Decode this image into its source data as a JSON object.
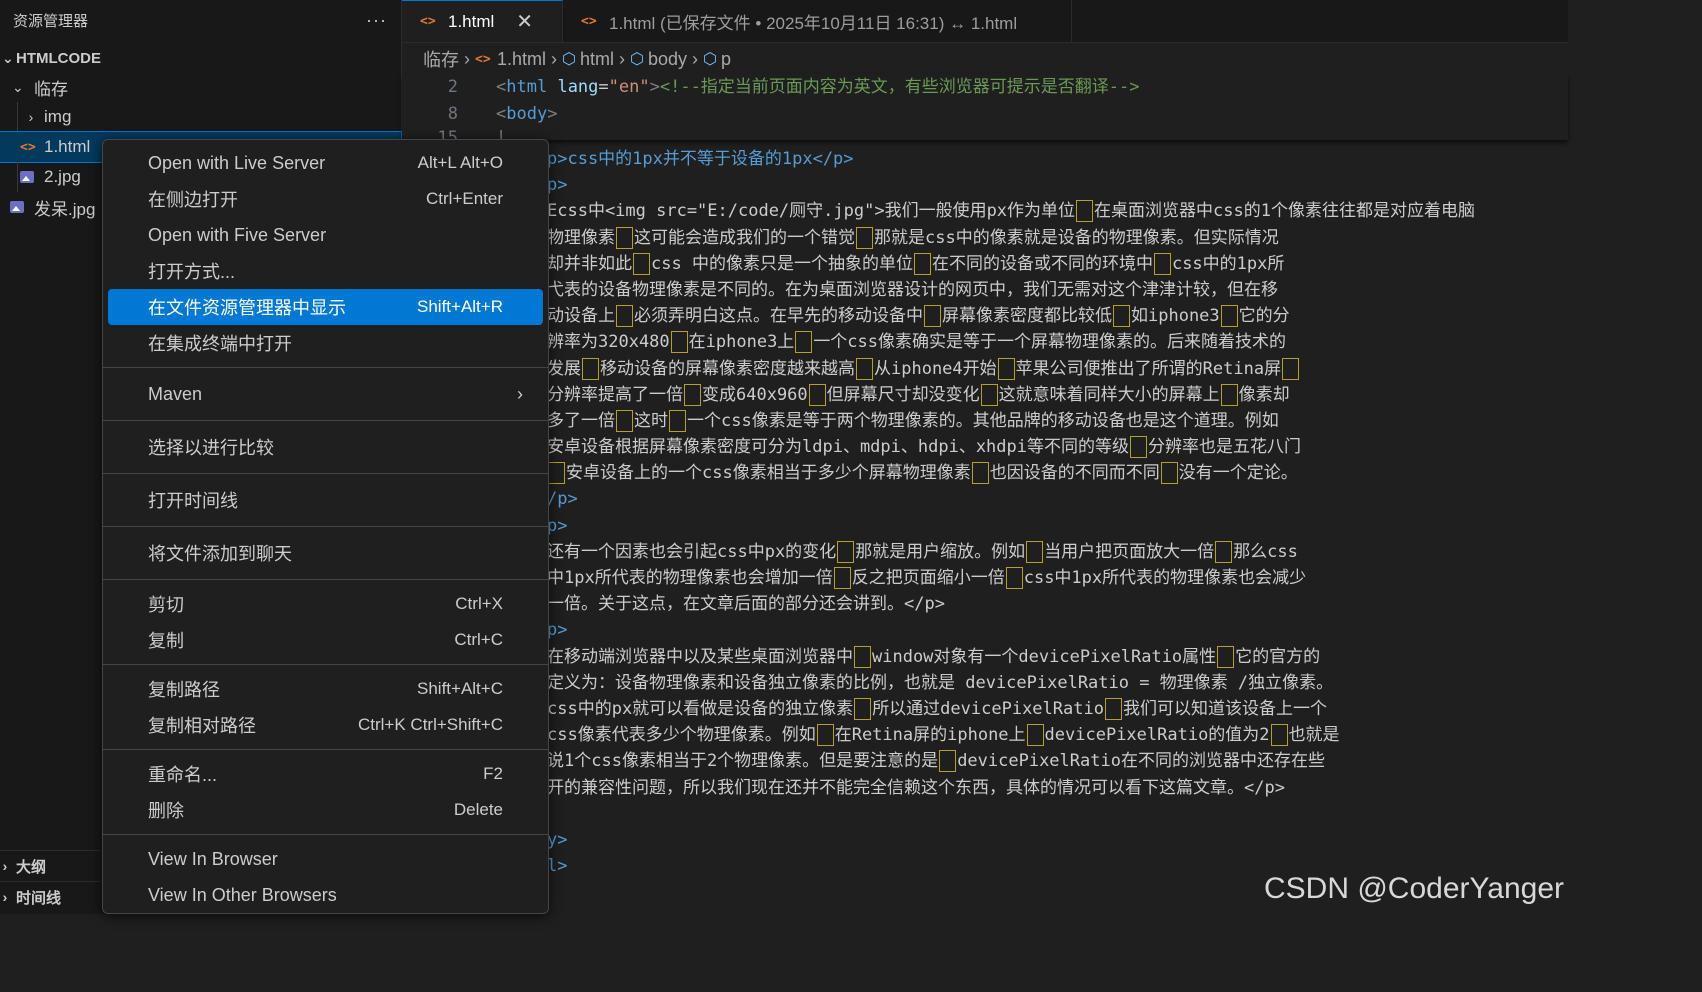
{
  "sidebar": {
    "title": "资源管理器",
    "more": "···",
    "section": "HTMLCODE",
    "tree": [
      {
        "label": "临存",
        "type": "folder-open"
      },
      {
        "label": "img",
        "type": "folder-closed"
      },
      {
        "label": "1.html",
        "type": "html"
      },
      {
        "label": "2.jpg",
        "type": "image"
      },
      {
        "label": "发呆.jpg",
        "type": "image"
      }
    ],
    "bottom": {
      "outline": "大纲",
      "timeline": "时间线"
    }
  },
  "tabs": [
    {
      "label": "1.html",
      "close": "✕"
    },
    {
      "label": "1.html (已保存文件 • 2025年10月11日 16:31) ↔ 1.html"
    }
  ],
  "breadcrumb": [
    "临存",
    "1.html",
    "html",
    "body",
    "p"
  ],
  "sticky": [
    {
      "num": "2",
      "tag": "html",
      "attr": "lang",
      "val": "\"en\"",
      "comment": "<!--指定当前页面内容为英文，有些浏览器可提示是否翻译-->"
    },
    {
      "num": "8",
      "tag": "body"
    },
    {
      "num": "15"
    }
  ],
  "code": [
    "p>css中的1px并不等于设备的1px</p>",
    "p>",
    "Ecss中<img src=\"E:/code/厕守.jpg\">我们一般使用px作为单位",
    "物理像素",
    "却并非如此",
    "弋表的设备物理像素是不同的。在为桌面浏览器设计的网页中，我们无需对这个津津计较，但在移",
    "动设备上",
    "辨率为320x480",
    "发展",
    "分辨率提高了一倍",
    "多了一倍",
    "安卓设备根据屏幕像素密度可分为ldpi、mdpi、hdpi、xhdpi等不同的等级",
    "安卓设备上的一个css像素相当于多少个屏幕物理像素",
    "/p>",
    "p>",
    "还有一个因素也会引起css中px的变化",
    "中1px所代表的物理像素也会增加一倍",
    "一倍。关于这点，在文章后面的部分还会讲到。</p>",
    "p>",
    "在移动端浏览器中以及某些桌面浏览器中",
    "定义为：设备物理像素和设备独立像素的比例，也就是 devicePixelRatio = 物理像素 /独立像素。",
    "css中的px就可以看做是设备的独立像素",
    "css像素代表多少个物理像素。例如",
    "说1个css像素相当于2个物理像素。但是要注意的是",
    "开的兼容性问题，所以我们现在还并不能完全信赖这个东西，具体的情况可以看下这篇文章。</p>",
    "",
    "y>",
    "l>"
  ],
  "code_tail": [
    "在桌面浏览器中css的1个像素往往都是对应着电脑",
    "这可能会造成我们的一个错觉",
    "那就是css中的像素就是设备的物理像素。但实际情况",
    "css 中的像素只是一个抽象的单位",
    "在不同的设备或不同的环境中",
    "css中的1px所",
    "必须弄明白这点。在早先的移动设备中",
    "屏幕像素密度都比较低",
    "如iphone3",
    "它的分",
    "在iphone3上",
    "一个css像素确实是等于一个屏幕物理像素的。后来随着技术的",
    "移动设备的屏幕像素密度越来越高",
    "从iphone4开始",
    "苹果公司便推出了所谓的Retina屏",
    "变成640x960",
    "但屏幕尺寸却没变化",
    "这就意味着同样大小的屏幕上",
    "像素却",
    "这时",
    "一个css像素是等于两个物理像素的。其他品牌的移动设备也是这个道理。例如",
    "分辨率也是五花八门",
    "也因设备的不同而不同",
    "没有一个定论。",
    "那就是用户缩放。例如",
    "当用户把页面放大一倍",
    "那么css",
    "反之把页面缩小一倍",
    "css中1px所代表的物理像素也会减少",
    "window对象有一个devicePixelRatio属性",
    "它的官方的",
    "所以通过devicePixelRatio",
    "我们可以知道该设备上一个",
    "在Retina屏的iphone上",
    "devicePixelRatio的值为2",
    "也就是",
    "devicePixelRatio在不同的浏览器中还存在些"
  ],
  "context_menu": [
    {
      "label": "Open with Live Server",
      "shortcut": "Alt+L Alt+O"
    },
    {
      "label": "在侧边打开",
      "shortcut": "Ctrl+Enter"
    },
    {
      "label": "Open with Five Server",
      "shortcut": ""
    },
    {
      "label": "打开方式...",
      "shortcut": ""
    },
    {
      "label": "在文件资源管理器中显示",
      "shortcut": "Shift+Alt+R"
    },
    {
      "label": "在集成终端中打开",
      "shortcut": ""
    },
    {
      "label": "Maven",
      "shortcut": ""
    },
    {
      "label": "选择以进行比较",
      "shortcut": ""
    },
    {
      "label": "打开时间线",
      "shortcut": ""
    },
    {
      "label": "将文件添加到聊天",
      "shortcut": ""
    },
    {
      "label": "剪切",
      "shortcut": "Ctrl+X"
    },
    {
      "label": "复制",
      "shortcut": "Ctrl+C"
    },
    {
      "label": "复制路径",
      "shortcut": "Shift+Alt+C"
    },
    {
      "label": "复制相对路径",
      "shortcut": "Ctrl+K Ctrl+Shift+C"
    },
    {
      "label": "重命名...",
      "shortcut": "F2"
    },
    {
      "label": "删除",
      "shortcut": "Delete"
    },
    {
      "label": "View In Browser",
      "shortcut": ""
    },
    {
      "label": "View In Other Browsers",
      "shortcut": ""
    }
  ],
  "watermark": "CSDN @CoderYanger",
  "colors": {
    "accent": "#0078d4",
    "sidebar_bg": "#181818",
    "editor_bg": "#1f1f1f",
    "tag": "#569cd6",
    "attr": "#9cdcfe",
    "string": "#ce9178",
    "comment": "#6a9955",
    "html_icon": "#e37933"
  }
}
